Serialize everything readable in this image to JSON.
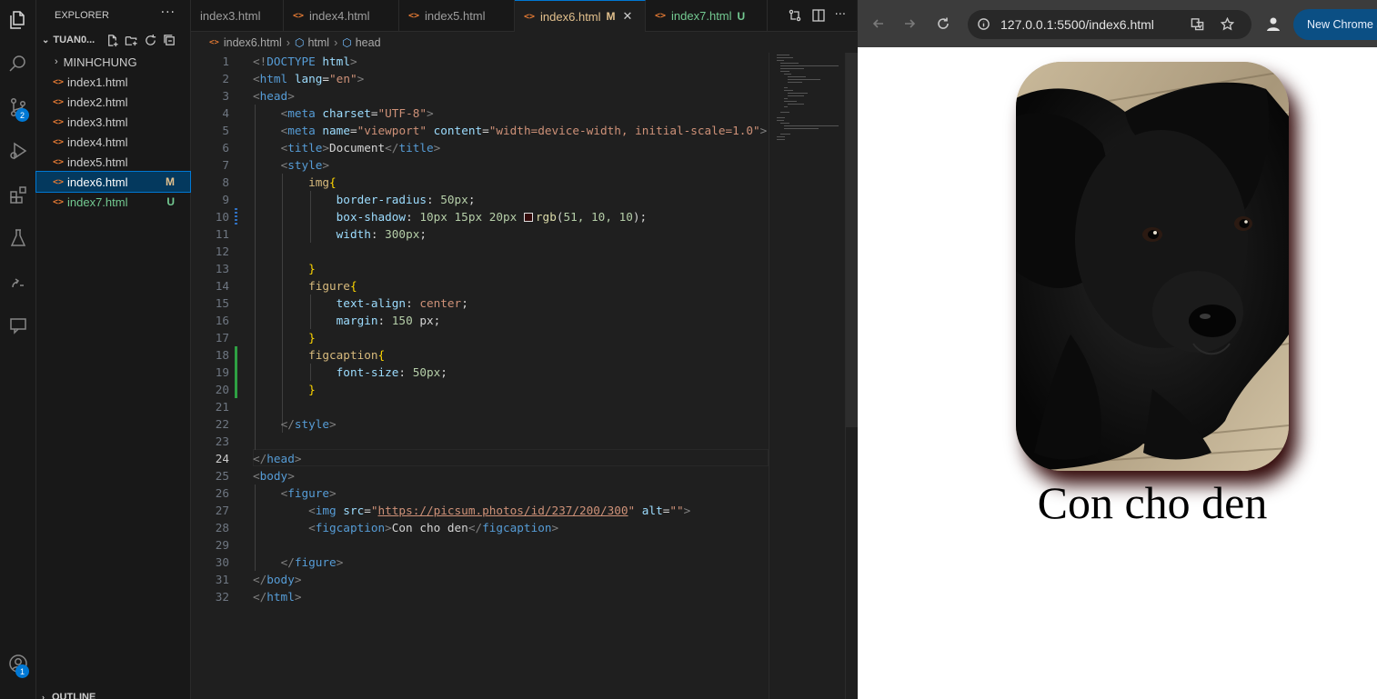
{
  "explorer": {
    "title": "EXPLORER",
    "more": "···",
    "folder": "TUAN0...",
    "items": [
      {
        "label": "MINHCHUNG",
        "status": ""
      },
      {
        "label": "index1.html",
        "status": ""
      },
      {
        "label": "index2.html",
        "status": ""
      },
      {
        "label": "index3.html",
        "status": ""
      },
      {
        "label": "index4.html",
        "status": ""
      },
      {
        "label": "index5.html",
        "status": ""
      },
      {
        "label": "index6.html",
        "status": "M"
      },
      {
        "label": "index7.html",
        "status": "U"
      }
    ],
    "outline": "OUTLINE"
  },
  "activity": {
    "source_control_badge": "2",
    "account_badge": "1"
  },
  "tabs": [
    {
      "label": "index3.html",
      "status": ""
    },
    {
      "label": "index4.html",
      "status": ""
    },
    {
      "label": "index5.html",
      "status": ""
    },
    {
      "label": "index6.html",
      "status": "M",
      "close": "✕"
    },
    {
      "label": "index7.html",
      "status": "U"
    }
  ],
  "breadcrumb": {
    "file": "index6.html",
    "node1": "html",
    "node2": "head"
  },
  "editor": {
    "current_line": 24,
    "line_numbers": [
      "1",
      "2",
      "3",
      "4",
      "5",
      "6",
      "7",
      "8",
      "9",
      "10",
      "11",
      "12",
      "13",
      "14",
      "15",
      "16",
      "17",
      "18",
      "19",
      "20",
      "21",
      "22",
      "23",
      "24",
      "25",
      "26",
      "27",
      "28",
      "29",
      "30",
      "31",
      "32"
    ],
    "code": {
      "l1a": "<!",
      "l1b": "DOCTYPE",
      "l1c": " html",
      "l1d": ">",
      "l2a": "<",
      "l2b": "html",
      "l2c": " lang",
      "l2d": "=",
      "l2e": "\"en\"",
      "l2f": ">",
      "l3a": "<",
      "l3b": "head",
      "l3c": ">",
      "l4a": "<",
      "l4b": "meta",
      "l4c": " charset",
      "l4d": "=",
      "l4e": "\"UTF-8\"",
      "l4f": ">",
      "l5a": "<",
      "l5b": "meta",
      "l5c": " name",
      "l5d": "=",
      "l5e": "\"viewport\"",
      "l5f": " content",
      "l5g": "=",
      "l5h": "\"width=device-width, initial-scale=1.0\"",
      "l5i": ">",
      "l6a": "<",
      "l6b": "title",
      "l6c": ">",
      "l6d": "Document",
      "l6e": "</",
      "l6f": "title",
      "l6g": ">",
      "l7a": "<",
      "l7b": "style",
      "l7c": ">",
      "l8a": "img",
      "l8b": "{",
      "l9a": "border-radius",
      "l9b": ": ",
      "l9c": "50px",
      "l9d": ";",
      "l10a": "box-shadow",
      "l10b": ": ",
      "l10c": "10px 15px 20px ",
      "l10d": "rgb",
      "l10e": "(",
      "l10f": "51, 10, 10",
      "l10g": ");",
      "l11a": "width",
      "l11b": ": ",
      "l11c": "300px",
      "l11d": ";",
      "l13a": "}",
      "l14a": "figure",
      "l14b": "{",
      "l15a": "text-align",
      "l15b": ": ",
      "l15c": "center",
      "l15d": ";",
      "l16a": "margin",
      "l16b": ": ",
      "l16c": "150",
      "l16d": " px",
      "l16e": ";",
      "l17a": "}",
      "l18a": "figcaption",
      "l18b": "{",
      "l19a": "font-size",
      "l19b": ": ",
      "l19c": "50px",
      "l19d": ";",
      "l20a": "}",
      "l22a": "</",
      "l22b": "style",
      "l22c": ">",
      "l24a": "</",
      "l24b": "head",
      "l24c": ">",
      "l25a": "<",
      "l25b": "body",
      "l25c": ">",
      "l26a": "<",
      "l26b": "figure",
      "l26c": ">",
      "l27a": "<",
      "l27b": "img",
      "l27c": " src",
      "l27d": "=",
      "l27e": "\"",
      "l27f": "https://picsum.photos/id/237/200/300",
      "l27g": "\"",
      "l27h": " alt",
      "l27i": "=",
      "l27j": "\"\"",
      "l27k": ">",
      "l28a": "<",
      "l28b": "figcaption",
      "l28c": ">",
      "l28d": "Con cho den",
      "l28e": "</",
      "l28f": "figcaption",
      "l28g": ">",
      "l30a": "</",
      "l30b": "figure",
      "l30c": ">",
      "l31a": "</",
      "l31b": "body",
      "l31c": ">",
      "l32a": "</",
      "l32b": "html",
      "l32c": ">"
    }
  },
  "browser": {
    "url": "127.0.0.1:5500/index6.html",
    "new_chrome_label": "New Chrome a",
    "caption": "Con cho den"
  },
  "colors": {
    "accent": "#0078d4",
    "shadow": "rgb(51,10,10)",
    "modified": "#e2c08d",
    "untracked": "#73c991"
  }
}
